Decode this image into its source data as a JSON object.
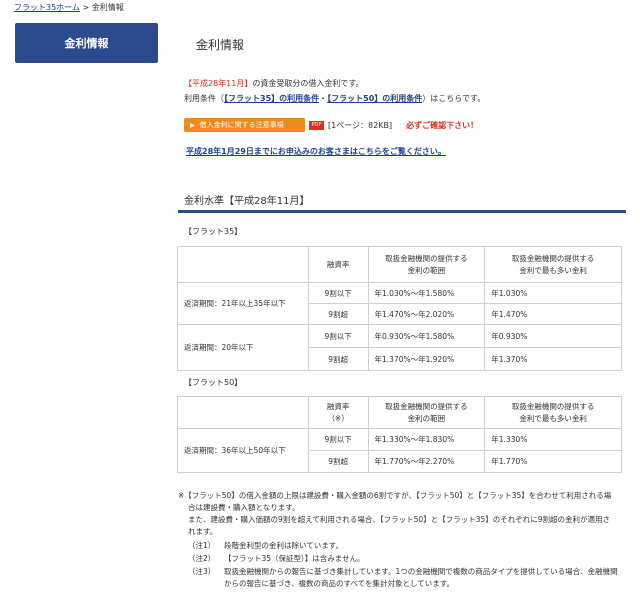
{
  "breadcrumb": {
    "home_link": "フラット35ホーム",
    "separator": ">",
    "current": "金利情報"
  },
  "sidebar": {
    "tab_label": "金利情報"
  },
  "page": {
    "title": "金利情報"
  },
  "intro": {
    "line1_red": "【平成28年11月】",
    "line1_text": "の資金受取分の借入金利です。",
    "line2_prefix": "利用条件（",
    "link35": "【フラット35】の利用条件",
    "sep": "・",
    "link50": "【フラット50】の利用条件",
    "line2_suffix": "）はこちらです。"
  },
  "notice": {
    "button_label": "借入金利に関する注意事項",
    "pdf_icon": "PDF",
    "pdf_size": "[1ページ：82KB]",
    "confirm": "必ずご確認下さい！"
  },
  "old_link": "平成28年1月29日までにお申込みのお客さまはこちらをご覧ください。",
  "section": {
    "title": "金利水準【平成28年11月】"
  },
  "flat35": {
    "heading": "【フラット35】",
    "headers": {
      "ratio": "融資率",
      "range": "取扱金融機関の提供する\n金利の範囲",
      "most": "取扱金融機関の提供する\n金利で最も多い金利"
    },
    "rows": [
      {
        "term": "返済期間：21年以上35年以下",
        "items": [
          {
            "ratio": "9割以下",
            "range": "年1.030%～年1.580%",
            "most": "年1.030%"
          },
          {
            "ratio": "9割超",
            "range": "年1.470%～年2.020%",
            "most": "年1.470%"
          }
        ]
      },
      {
        "term": "返済期間：20年以下",
        "items": [
          {
            "ratio": "9割以下",
            "range": "年0.930%～年1.580%",
            "most": "年0.930%"
          },
          {
            "ratio": "9割超",
            "range": "年1.370%～年1.920%",
            "most": "年1.370%"
          }
        ]
      }
    ]
  },
  "flat50": {
    "heading": "【フラット50】",
    "headers": {
      "ratio": "融資率\n（※）",
      "range": "取扱金融機関の提供する\n金利の範囲",
      "most": "取扱金融機関の提供する\n金利で最も多い金利"
    },
    "rows": [
      {
        "term": "返済期間：36年以上50年以下",
        "items": [
          {
            "ratio": "9割以下",
            "range": "年1.330%～年1.830%",
            "most": "年1.330%"
          },
          {
            "ratio": "9割超",
            "range": "年1.770%～年2.270%",
            "most": "年1.770%"
          }
        ]
      }
    ]
  },
  "notes": {
    "asterisk_line1": "※【フラット50】の借入金額の上限は建設費・購入金額の6割ですが、【フラット50】と【フラット35】を合わせて利用される場",
    "asterisk_line2": "合は建設費・購入額となります。",
    "asterisk_line3": "また、建設費・購入価額の9割を超えて利用される場合、【フラット50】と【フラット35】のそれぞれに9割超の金利が適用さ",
    "asterisk_line4": "れます。"
  },
  "footnotes": [
    {
      "label": "（注1）",
      "text": "段階金利型の金利は除いています。"
    },
    {
      "label": "（注2）",
      "text": "【フラット35（保証型）】は含みません。"
    },
    {
      "label": "（注3）",
      "text": "取扱金融機関からの報告に基づき集計しています。1つの金融機関で複数の商品タイプを提供している場合、金融機関からの報告に基づき、複数の商品のすべてを集計対象としています。"
    }
  ]
}
